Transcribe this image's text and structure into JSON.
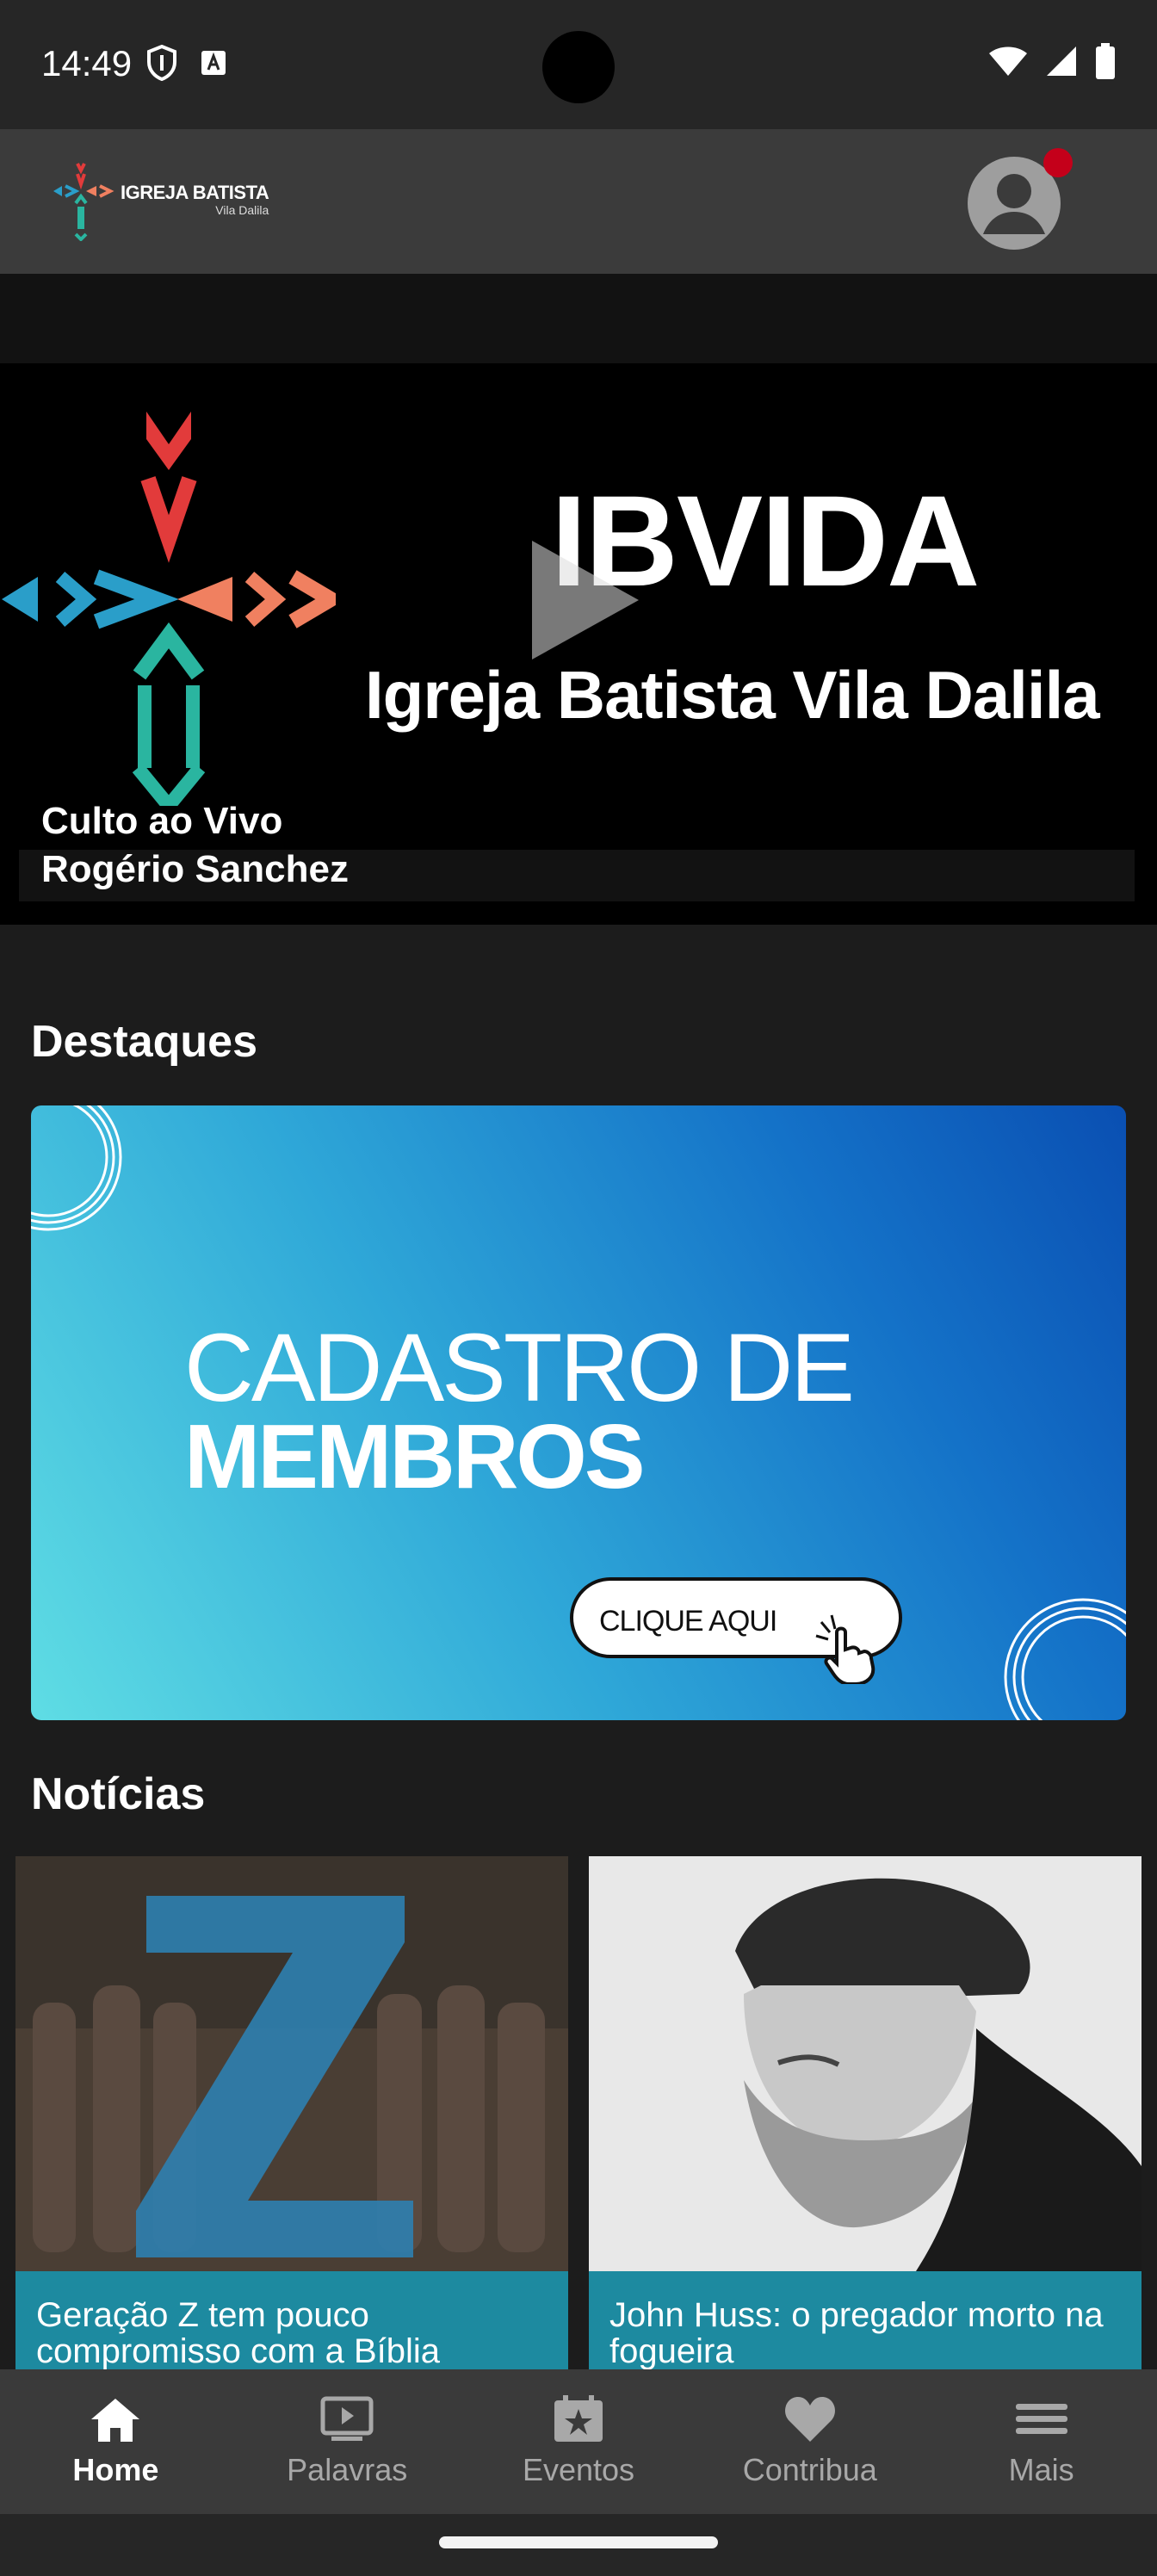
{
  "status_bar": {
    "time": "14:49",
    "icons_left": [
      "shield-icon",
      "accessibility-a-icon"
    ],
    "icons_right": [
      "wifi-icon",
      "signal-icon",
      "battery-icon"
    ]
  },
  "app_bar": {
    "logo_title": "IGREJA BATISTA",
    "logo_subtitle": "Vila Dalila",
    "avatar_icon": "account-circle-icon",
    "notification_dot_color": "#c4001a"
  },
  "hero": {
    "brand": "IBVIDA",
    "church_name": "Igreja Batista Vila Dalila",
    "caption_line1": "Culto ao Vivo",
    "caption_line2": "Rogério Sanchez",
    "play_icon": "play-icon"
  },
  "highlights": {
    "section_title": "Destaques",
    "banner": {
      "line1": "CADASTRO DE",
      "line2": "MEMBROS",
      "button_label": "CLIQUE AQUI",
      "button_icon": "pointing-hand-icon"
    }
  },
  "news": {
    "section_title": "Notícias",
    "items": [
      {
        "title": "Geração Z tem pouco compromisso com a Bíblia",
        "image": "generation-z-image"
      },
      {
        "title": "John Huss: o pregador morto na fogueira",
        "image": "john-huss-portrait"
      }
    ]
  },
  "bottom_nav": {
    "items": [
      {
        "label": "Home",
        "icon": "home-icon",
        "active": true
      },
      {
        "label": "Palavras",
        "icon": "video-play-icon",
        "active": false
      },
      {
        "label": "Eventos",
        "icon": "calendar-star-icon",
        "active": false
      },
      {
        "label": "Contribua",
        "icon": "heart-icon",
        "active": false
      },
      {
        "label": "Mais",
        "icon": "menu-icon",
        "active": false
      }
    ]
  },
  "colors": {
    "accent_teal": "#1d8aa0",
    "cross_red": "#e23b3b",
    "cross_blue": "#2a9ec9",
    "cross_orange": "#f08060",
    "cross_teal": "#2ab5a0"
  }
}
